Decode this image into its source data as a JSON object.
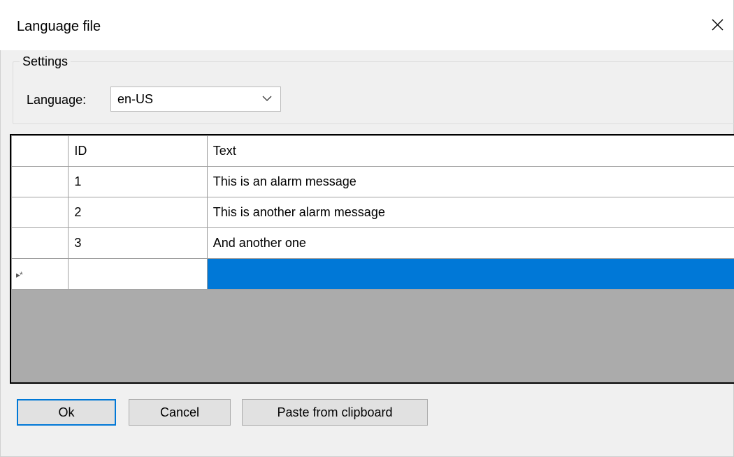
{
  "window": {
    "title": "Language file",
    "close_icon": "close-icon"
  },
  "settings": {
    "group_label": "Settings",
    "language_label": "Language:",
    "language_value": "en-US",
    "dropdown_icon": "chevron-down-icon"
  },
  "grid": {
    "columns": [
      "ID",
      "Text"
    ],
    "rows": [
      {
        "id": "1",
        "text": "This is an alarm message"
      },
      {
        "id": "2",
        "text": "This is another alarm message"
      },
      {
        "id": "3",
        "text": "And another one"
      }
    ],
    "new_row_marker": "▸*",
    "selection_color": "#0078d7",
    "background_color": "#ababab"
  },
  "buttons": {
    "ok": "Ok",
    "cancel": "Cancel",
    "paste": "Paste from clipboard",
    "accent": "#0078d7"
  }
}
